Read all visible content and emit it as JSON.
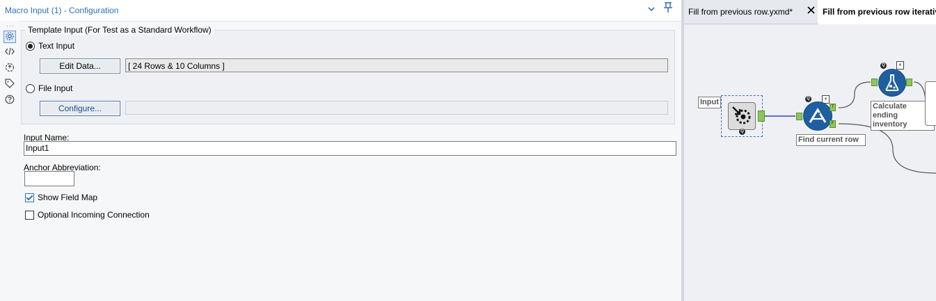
{
  "config_panel": {
    "title": "Macro Input (1) - Configuration",
    "chevron_icon": "chevron-down-icon",
    "pin_icon": "pin-icon",
    "rail_overflow": "···",
    "rail_icons": [
      "settings-icon",
      "code-icon",
      "tool-connection-icon",
      "tag-icon",
      "help-icon"
    ],
    "template_group": {
      "legend": "Template Input (For Test as a Standard Workflow)",
      "text_input_label": "Text Input",
      "text_input_selected": true,
      "edit_data_button": "Edit Data...",
      "data_summary": "[ 24 Rows & 10 Columns ]",
      "file_input_label": "File Input",
      "file_input_selected": false,
      "configure_button": "Configure...",
      "file_path": ""
    },
    "input_name_label": "Input Name:",
    "input_name_value": "Input1",
    "anchor_abbreviation_label": "Anchor Abbreviation:",
    "anchor_abbreviation_value": "",
    "show_field_map_label": "Show Field Map",
    "show_field_map_checked": true,
    "optional_incoming_label": "Optional Incoming Connection",
    "optional_incoming_checked": false
  },
  "workflow": {
    "tabs": [
      {
        "label": "Fill from previous row.yxmd*",
        "active": false,
        "close_icon": "close-icon"
      },
      {
        "label": "Fill  from  previous row  iterative",
        "active": true
      }
    ],
    "tools": [
      {
        "name": "macro-input-tool",
        "label": "Input",
        "icon": "macro-input-icon",
        "badge": "Q"
      },
      {
        "name": "filter-tool",
        "label": "Find current row",
        "icon": "filter-icon",
        "badge": "Q",
        "anchor_true": "T",
        "anchor_false": "F"
      },
      {
        "name": "formula-tool",
        "label": "Calculate ending inventory",
        "icon": "formula-icon",
        "badge": "Q"
      }
    ],
    "colors": {
      "connection": "#3b3bbf",
      "tool_blue": "#1f5fa0",
      "anchor_green": "#8fc65a"
    }
  }
}
